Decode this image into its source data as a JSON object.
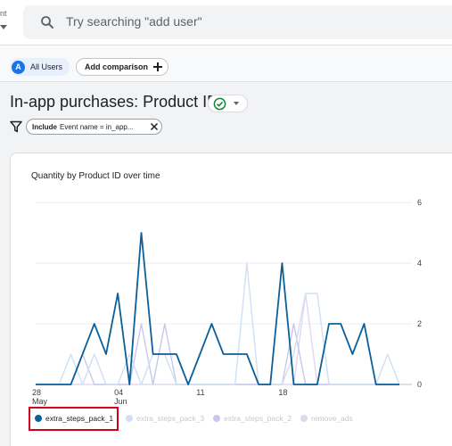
{
  "topbar": {
    "property_fragment": "nt",
    "search_placeholder": "Try searching \"add user\""
  },
  "comparison": {
    "segment_avatar": "A",
    "segment_label": "All Users",
    "add_label": "Add comparison"
  },
  "page": {
    "title": "In-app purchases: Product ID"
  },
  "filter": {
    "include_label": "Include",
    "text": "Event name = in_app..."
  },
  "chart_data": {
    "type": "line",
    "title": "Quantity by Product ID over time",
    "x_tick_labels": [
      {
        "label": "28",
        "sublabel": "May",
        "index": 0
      },
      {
        "label": "04",
        "sublabel": "Jun",
        "index": 7
      },
      {
        "label": "11",
        "sublabel": "",
        "index": 14
      },
      {
        "label": "18",
        "sublabel": "",
        "index": 21
      }
    ],
    "y_ticks": [
      0,
      2,
      4,
      6
    ],
    "ylim": [
      0,
      6
    ],
    "x": [
      "May 28",
      "May 29",
      "May 30",
      "May 31",
      "Jun 01",
      "Jun 02",
      "Jun 03",
      "Jun 04",
      "Jun 05",
      "Jun 06",
      "Jun 07",
      "Jun 08",
      "Jun 09",
      "Jun 10",
      "Jun 11",
      "Jun 12",
      "Jun 13",
      "Jun 14",
      "Jun 15",
      "Jun 16",
      "Jun 17",
      "Jun 18",
      "Jun 19",
      "Jun 20",
      "Jun 21",
      "Jun 22",
      "Jun 23",
      "Jun 24",
      "Jun 25",
      "Jun 26",
      "Jun 27",
      "Jun 28"
    ],
    "series": [
      {
        "name": "extra_steps_pack_1",
        "color": "#0b5f9a",
        "values": [
          0,
          0,
          0,
          0,
          1,
          2,
          1,
          3,
          0,
          5,
          1,
          1,
          1,
          0,
          1,
          2,
          1,
          1,
          1,
          0,
          0,
          4,
          0,
          0,
          0,
          2,
          2,
          1,
          2,
          0,
          0,
          0
        ]
      },
      {
        "name": "extra_steps_pack_3",
        "color": "#cfe0f3",
        "values": [
          0,
          0,
          0,
          1,
          0,
          1,
          0,
          0,
          1,
          0,
          1,
          1,
          0,
          0,
          0,
          0,
          0,
          0,
          4,
          0,
          0,
          0,
          1,
          3,
          3,
          0,
          0,
          0,
          0,
          0,
          1,
          0
        ]
      },
      {
        "name": "extra_steps_pack_2",
        "color": "#c8c7ee",
        "values": [
          0,
          0,
          0,
          0,
          1,
          0,
          0,
          0,
          0,
          2,
          0,
          2,
          0,
          0,
          0,
          0,
          0,
          0,
          0,
          0,
          0,
          0,
          2,
          0,
          0,
          0,
          0,
          0,
          0,
          0,
          0,
          0
        ]
      },
      {
        "name": "remove_ads",
        "color": "#e3d7ef",
        "values": [
          0,
          0,
          0,
          0,
          0,
          0,
          0,
          0,
          0,
          0,
          0,
          0,
          0,
          0,
          0,
          0,
          0,
          0,
          0,
          0,
          0,
          0,
          0,
          3,
          0,
          0,
          0,
          0,
          0,
          0,
          0,
          0
        ]
      }
    ],
    "legend_position": "bottom-left",
    "grid": true
  }
}
